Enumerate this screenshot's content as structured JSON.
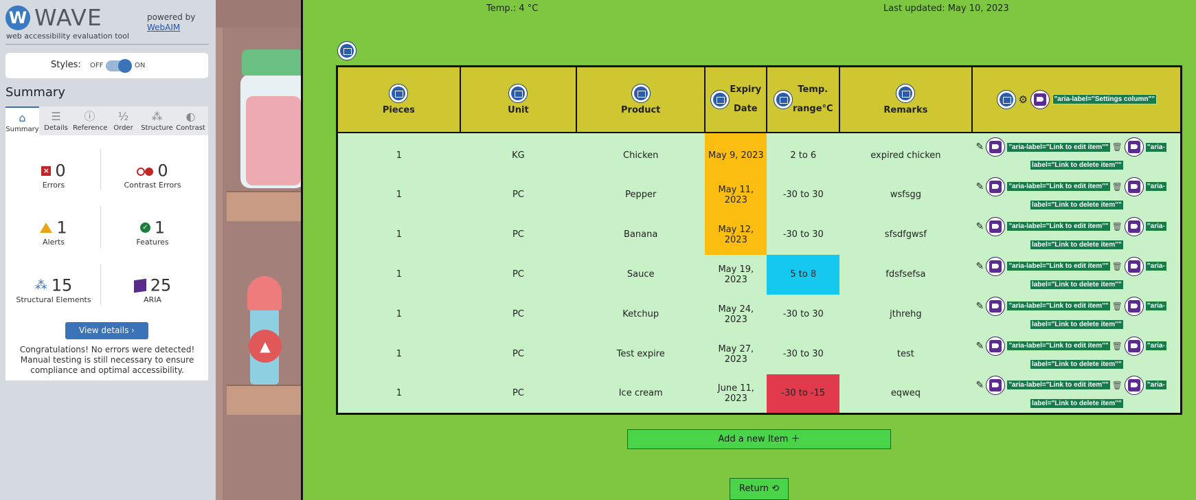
{
  "wave": {
    "logo_letter": "W",
    "logo_text": "WAVE",
    "tagline": "web accessibility evaluation tool",
    "powered_by": "powered by",
    "webaim": "WebAIM",
    "styles_label": "Styles:",
    "styles_off": "OFF",
    "styles_on": "ON",
    "summary_title": "Summary",
    "tabs": [
      {
        "label": "Summary",
        "icon": "⌂"
      },
      {
        "label": "Details",
        "icon": "☰"
      },
      {
        "label": "Reference",
        "icon": "ⓘ"
      },
      {
        "label": "Order",
        "icon": "½"
      },
      {
        "label": "Structure",
        "icon": "⁂"
      },
      {
        "label": "Contrast",
        "icon": "◐"
      }
    ],
    "stats": {
      "errors": {
        "count": "0",
        "label": "Errors"
      },
      "contrast_errors": {
        "count": "0",
        "label": "Contrast Errors"
      },
      "alerts": {
        "count": "1",
        "label": "Alerts"
      },
      "features": {
        "count": "1",
        "label": "Features"
      },
      "structural": {
        "count": "15",
        "label": "Structural Elements"
      },
      "aria": {
        "count": "25",
        "label": "ARIA"
      }
    },
    "view_details": "View details ›",
    "congrats": "Congratulations! No errors were detected! Manual testing is still necessary to ensure compliance and optimal accessibility."
  },
  "app": {
    "temp": "Temp.: 4 °C",
    "updated": "Last updated: May 10, 2023",
    "columns": {
      "pieces": "Pieces",
      "unit": "Unit",
      "product": "Product",
      "expiry_1": "Expiry",
      "expiry_2": "Date",
      "temp_1": "Temp.",
      "temp_2": "range°C",
      "remarks": "Remarks",
      "settings_aria": "\"aria-label=\"Settings column\"\""
    },
    "edit_aria": "\"aria-label=\"Link to edit item\"\"",
    "delete_aria_a": "\"aria-",
    "delete_aria_b": "label=\"Link to delete item\"\"",
    "rows": [
      {
        "pieces": "1",
        "unit": "KG",
        "product": "Chicken",
        "expiry": "May 9, 2023",
        "temp": "2 to 6",
        "remarks": "expired chicken"
      },
      {
        "pieces": "1",
        "unit": "PC",
        "product": "Pepper",
        "expiry": "May 11, 2023",
        "temp": "-30 to 30",
        "remarks": "wsfsgg"
      },
      {
        "pieces": "1",
        "unit": "PC",
        "product": "Banana",
        "expiry": "May 12, 2023",
        "temp": "-30 to 30",
        "remarks": "sfsdfgwsf"
      },
      {
        "pieces": "1",
        "unit": "PC",
        "product": "Sauce",
        "expiry": "May 19, 2023",
        "temp": "5 to 8",
        "remarks": "fdsfsefsa"
      },
      {
        "pieces": "1",
        "unit": "PC",
        "product": "Ketchup",
        "expiry": "May 24, 2023",
        "temp": "-30 to 30",
        "remarks": "jthrehg"
      },
      {
        "pieces": "1",
        "unit": "PC",
        "product": "Test expire",
        "expiry": "May 27, 2023",
        "temp": "-30 to 30",
        "remarks": "test"
      },
      {
        "pieces": "1",
        "unit": "PC",
        "product": "Ice cream",
        "expiry": "June 11, 2023",
        "temp": "-30 to -15",
        "remarks": "eqweq"
      }
    ],
    "add_button": "Add a new Item ＋",
    "return_button": "Return ⟲",
    "colors": {
      "page_bg": "#7dc840",
      "header_bg": "#cfc732",
      "row_bg": "#c8f1c8",
      "expiring": "#fbbd10",
      "temp_cold": "#14c8ef",
      "temp_frozen": "#e03a4c",
      "button": "#4ad44a"
    }
  }
}
